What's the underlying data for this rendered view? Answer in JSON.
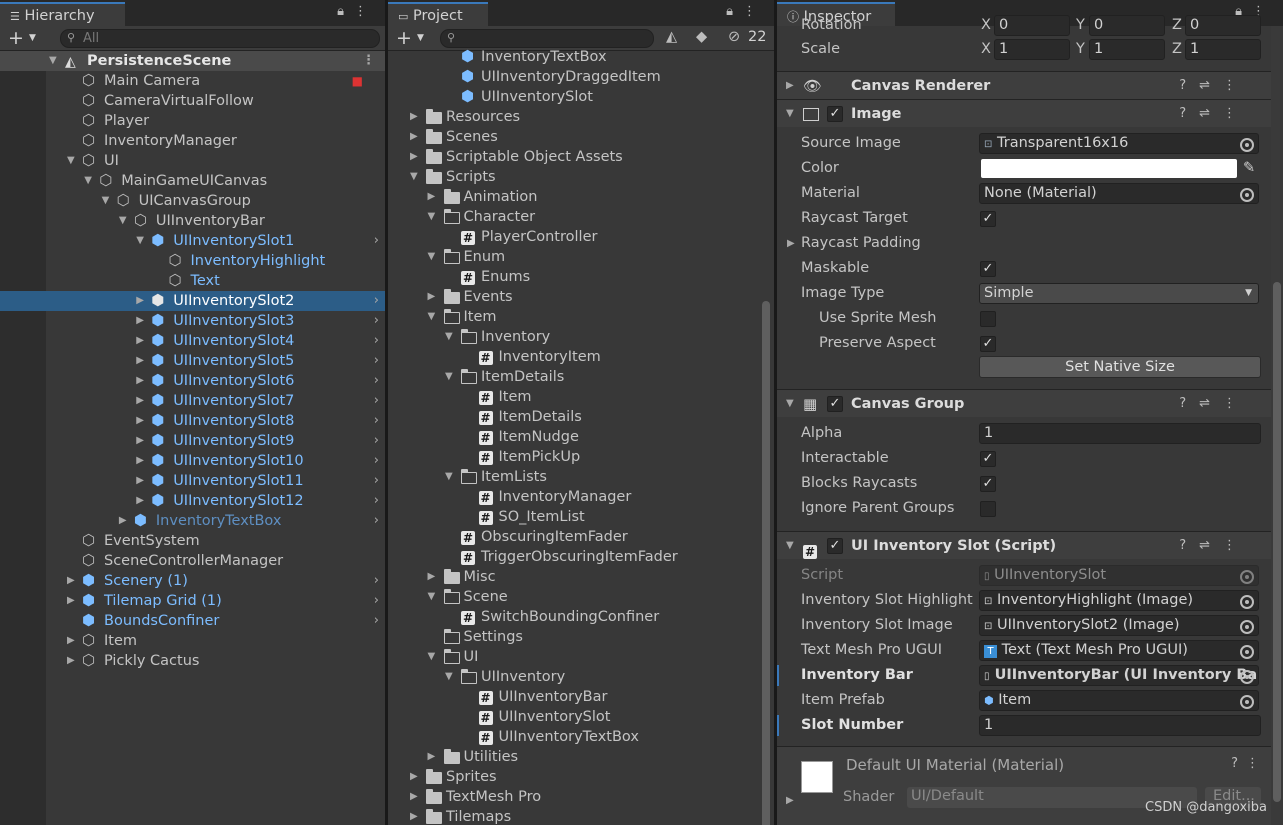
{
  "hierarchy": {
    "tab": "Hierarchy",
    "search_placeholder": "All",
    "scene": "PersistenceScene",
    "items": [
      {
        "label": "Main Camera",
        "badge": true
      },
      {
        "label": "CameraVirtualFollow"
      },
      {
        "label": "Player"
      },
      {
        "label": "InventoryManager"
      },
      {
        "label": "UI"
      },
      {
        "label": "MainGameUICanvas"
      },
      {
        "label": "UICanvasGroup"
      },
      {
        "label": "UIInventoryBar"
      },
      {
        "label": "UIInventorySlot1"
      },
      {
        "label": "InventoryHighlight"
      },
      {
        "label": "Text"
      },
      {
        "label": "UIInventorySlot2"
      },
      {
        "label": "UIInventorySlot3"
      },
      {
        "label": "UIInventorySlot4"
      },
      {
        "label": "UIInventorySlot5"
      },
      {
        "label": "UIInventorySlot6"
      },
      {
        "label": "UIInventorySlot7"
      },
      {
        "label": "UIInventorySlot8"
      },
      {
        "label": "UIInventorySlot9"
      },
      {
        "label": "UIInventorySlot10"
      },
      {
        "label": "UIInventorySlot11"
      },
      {
        "label": "UIInventorySlot12"
      },
      {
        "label": "InventoryTextBox"
      },
      {
        "label": "EventSystem"
      },
      {
        "label": "SceneControllerManager"
      },
      {
        "label": "Scenery (1)"
      },
      {
        "label": "Tilemap Grid (1)"
      },
      {
        "label": "BoundsConfiner"
      },
      {
        "label": "Item"
      },
      {
        "label": "Pickly Cactus"
      }
    ]
  },
  "project": {
    "tab": "Project",
    "hidden_count": "22",
    "items": [
      {
        "label": "InventoryTextBox"
      },
      {
        "label": "UIInventoryDraggedItem"
      },
      {
        "label": "UIInventorySlot"
      },
      {
        "label": "Resources"
      },
      {
        "label": "Scenes"
      },
      {
        "label": "Scriptable Object Assets"
      },
      {
        "label": "Scripts"
      },
      {
        "label": "Animation"
      },
      {
        "label": "Character"
      },
      {
        "label": "PlayerController"
      },
      {
        "label": "Enum"
      },
      {
        "label": "Enums"
      },
      {
        "label": "Events"
      },
      {
        "label": "Item"
      },
      {
        "label": "Inventory"
      },
      {
        "label": "InventoryItem"
      },
      {
        "label": "ItemDetails"
      },
      {
        "label": "Item"
      },
      {
        "label": "ItemDetails"
      },
      {
        "label": "ItemNudge"
      },
      {
        "label": "ItemPickUp"
      },
      {
        "label": "ItemLists"
      },
      {
        "label": "InventoryManager"
      },
      {
        "label": "SO_ItemList"
      },
      {
        "label": "ObscuringItemFader"
      },
      {
        "label": "TriggerObscuringItemFader"
      },
      {
        "label": "Misc"
      },
      {
        "label": "Scene"
      },
      {
        "label": "SwitchBoundingConfiner"
      },
      {
        "label": "Settings"
      },
      {
        "label": "UI"
      },
      {
        "label": "UIInventory"
      },
      {
        "label": "UIInventoryBar"
      },
      {
        "label": "UIInventorySlot"
      },
      {
        "label": "UIInventoryTextBox"
      },
      {
        "label": "Utilities"
      },
      {
        "label": "Sprites"
      },
      {
        "label": "TextMesh Pro"
      },
      {
        "label": "Tilemaps"
      }
    ]
  },
  "inspector": {
    "tab": "Inspector",
    "rotation": {
      "label": "Rotation",
      "x": "0",
      "y": "0",
      "z": "0"
    },
    "scale": {
      "label": "Scale",
      "x": "1",
      "y": "1",
      "z": "1"
    },
    "axis": {
      "x": "X",
      "y": "Y",
      "z": "Z"
    },
    "canvas_renderer": "Canvas Renderer",
    "image": {
      "title": "Image",
      "source_image_label": "Source Image",
      "source_image": "Transparent16x16",
      "color_label": "Color",
      "material_label": "Material",
      "material": "None (Material)",
      "raycast_target": "Raycast Target",
      "raycast_padding": "Raycast Padding",
      "maskable": "Maskable",
      "image_type_label": "Image Type",
      "image_type": "Simple",
      "use_sprite_mesh": "Use Sprite Mesh",
      "preserve_aspect": "Preserve Aspect",
      "set_native_size": "Set Native Size"
    },
    "canvas_group": {
      "title": "Canvas Group",
      "alpha_label": "Alpha",
      "alpha": "1",
      "interactable": "Interactable",
      "blocks_raycasts": "Blocks Raycasts",
      "ignore_parent_groups": "Ignore Parent Groups"
    },
    "slot_script": {
      "title": "UI Inventory Slot (Script)",
      "script_label": "Script",
      "script": "UIInventorySlot",
      "highlight_label": "Inventory Slot Highlight",
      "highlight": "InventoryHighlight (Image)",
      "slot_image_label": "Inventory Slot Image",
      "slot_image": "UIInventorySlot2 (Image)",
      "tmp_label": "Text Mesh Pro UGUI",
      "tmp": "Text (Text Mesh Pro UGUI)",
      "bar_label": "Inventory Bar",
      "bar": "UIInventoryBar (UI Inventory Bar",
      "prefab_label": "Item Prefab",
      "prefab": "Item",
      "slot_number_label": "Slot Number",
      "slot_number": "1"
    },
    "material": {
      "title": "Default UI Material (Material)",
      "shader_label": "Shader",
      "shader": "UI/Default",
      "edit": "Edit..."
    }
  },
  "watermark": "CSDN @dangoxiba",
  "colors": {
    "selection": "#2c5d87",
    "prefab_text": "#7cbcff",
    "panel_bg": "#383838"
  }
}
